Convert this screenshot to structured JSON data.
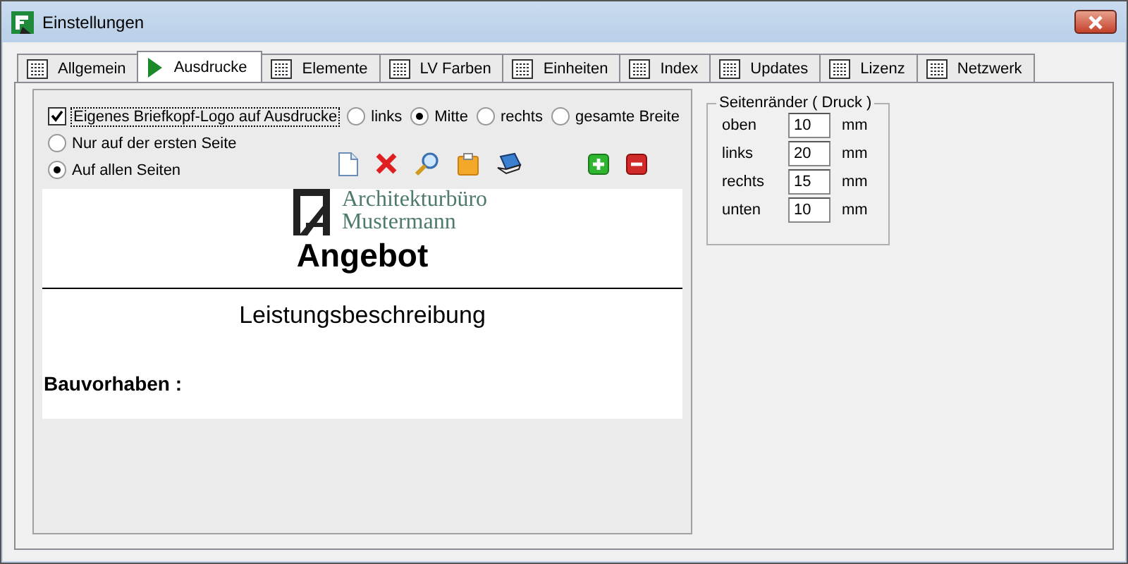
{
  "window": {
    "title": "Einstellungen"
  },
  "tabs": [
    {
      "label": "Allgemein",
      "selected": false
    },
    {
      "label": "Ausdrucke",
      "selected": true
    },
    {
      "label": "Elemente",
      "selected": false
    },
    {
      "label": "LV Farben",
      "selected": false
    },
    {
      "label": "Einheiten",
      "selected": false
    },
    {
      "label": "Index",
      "selected": false
    },
    {
      "label": "Updates",
      "selected": false
    },
    {
      "label": "Lizenz",
      "selected": false
    },
    {
      "label": "Netzwerk",
      "selected": false
    }
  ],
  "letterhead": {
    "label": "Eigenes Briefkopf-Logo auf Ausdrucke",
    "checked": true,
    "alignment": [
      {
        "label": "links",
        "selected": false
      },
      {
        "label": "Mitte",
        "selected": true
      },
      {
        "label": "rechts",
        "selected": false
      },
      {
        "label": "gesamte Breite",
        "selected": false
      }
    ],
    "pages": [
      {
        "label": "Nur auf der ersten Seite",
        "selected": false
      },
      {
        "label": "Auf allen Seiten",
        "selected": true
      }
    ]
  },
  "toolbar": [
    {
      "kind": "new"
    },
    {
      "kind": "delete"
    },
    {
      "kind": "search"
    },
    {
      "kind": "paste"
    },
    {
      "kind": "scan"
    },
    {
      "kind": "add"
    },
    {
      "kind": "remove"
    }
  ],
  "preview": {
    "logo_lines": [
      "Architekturbüro",
      "Mustermann"
    ],
    "title": "Angebot",
    "subtitle": "Leistungsbeschreibung",
    "project_label": "Bauvorhaben :"
  },
  "margins": {
    "title": "Seitenränder ( Druck )",
    "rows": [
      {
        "label": "oben",
        "value": "10",
        "unit": "mm"
      },
      {
        "label": "links",
        "value": "20",
        "unit": "mm"
      },
      {
        "label": "rechts",
        "value": "15",
        "unit": "mm"
      },
      {
        "label": "unten",
        "value": "10",
        "unit": "mm"
      }
    ]
  }
}
